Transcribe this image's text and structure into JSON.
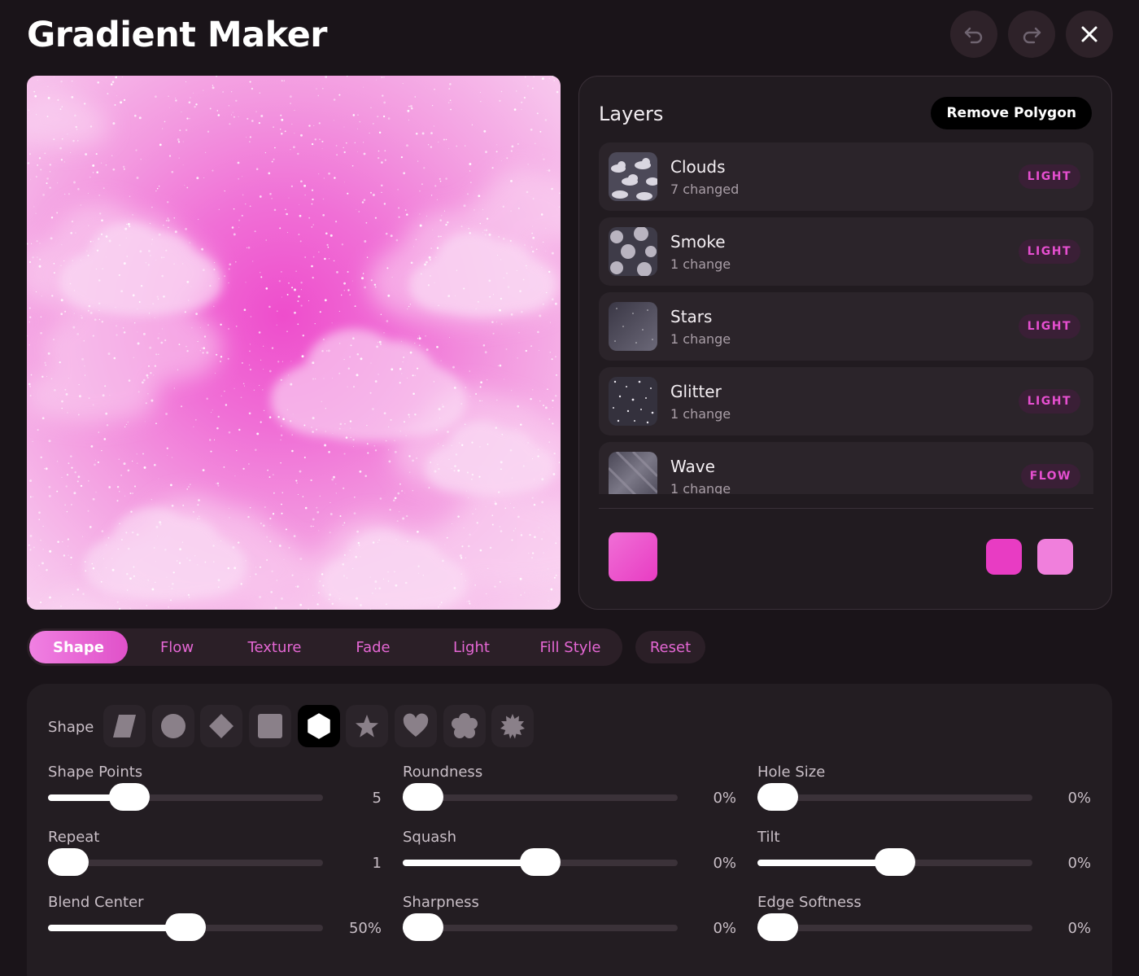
{
  "header": {
    "title": "Gradient Maker",
    "undo_icon": "undo-icon",
    "redo_icon": "redo-icon",
    "close_icon": "close-icon"
  },
  "layers": {
    "title": "Layers",
    "remove_label": "Remove Polygon",
    "items": [
      {
        "name": "Clouds",
        "sub": "7 changed",
        "badge": "LIGHT",
        "thumb": "clouds"
      },
      {
        "name": "Smoke",
        "sub": "1 change",
        "badge": "LIGHT",
        "thumb": "smoke"
      },
      {
        "name": "Stars",
        "sub": "1 change",
        "badge": "LIGHT",
        "thumb": "stars"
      },
      {
        "name": "Glitter",
        "sub": "1 change",
        "badge": "LIGHT",
        "thumb": "glitter"
      },
      {
        "name": "Wave",
        "sub": "1 change",
        "badge": "FLOW",
        "thumb": "wave"
      }
    ],
    "colors": {
      "main": "#e83cc3",
      "stop_a": "#e83cc3",
      "stop_b": "#f07fdc"
    }
  },
  "tabs": {
    "items": [
      "Shape",
      "Flow",
      "Texture",
      "Fade",
      "Light",
      "Fill Style"
    ],
    "active": "Shape",
    "reset_label": "Reset"
  },
  "settings": {
    "shape_label": "Shape",
    "shapes": [
      "parallelogram-icon",
      "circle-icon",
      "diamond-icon",
      "square-icon",
      "hexagon-icon",
      "star-icon",
      "heart-icon",
      "flower-icon",
      "burst-icon"
    ],
    "selected_shape": "hexagon-icon",
    "controls": [
      {
        "label": "Shape Points",
        "value": "5",
        "level": 0.26
      },
      {
        "label": "Roundness",
        "value": "0%",
        "level": 0
      },
      {
        "label": "Hole Size",
        "value": "0%",
        "level": 0
      },
      {
        "label": "Repeat",
        "value": "1",
        "level": 0
      },
      {
        "label": "Squash",
        "value": "0%",
        "level": 0.5
      },
      {
        "label": "Tilt",
        "value": "0%",
        "level": 0.5
      },
      {
        "label": "Blend Center",
        "value": "50%",
        "level": 0.5
      },
      {
        "label": "Sharpness",
        "value": "0%",
        "level": 0
      },
      {
        "label": "Edge Softness",
        "value": "0%",
        "level": 0
      }
    ]
  },
  "colors": {
    "accent": "#e567d4",
    "background": "#1a1419"
  }
}
